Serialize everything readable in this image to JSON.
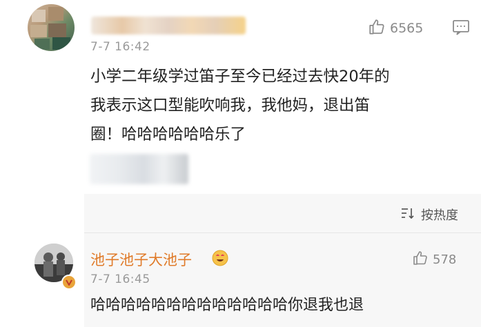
{
  "comment": {
    "time": "7-7 16:42",
    "likes": "6565",
    "text_line1": "小学二年级学过笛子至今已经过去快20年的",
    "text_line2": "我表示这口型能吹响我，我他妈，退出笛",
    "text_line3": "圈！哈哈哈哈哈哈乐了"
  },
  "replies_header": {
    "sort_label": "按热度"
  },
  "reply": {
    "author": "池子池子大池子",
    "time": "7-7 16:45",
    "likes": "578",
    "text": "哈哈哈哈哈哈哈哈哈哈哈哈哈你退我也退"
  },
  "colors": {
    "author_name": "#e07b2a",
    "badge": "#e9a43a",
    "meta_gray": "#9a9a9a"
  },
  "icons": [
    "thumbs-up-icon",
    "comment-icon",
    "sort-icon",
    "verified-badge-icon",
    "emoji-icon"
  ]
}
